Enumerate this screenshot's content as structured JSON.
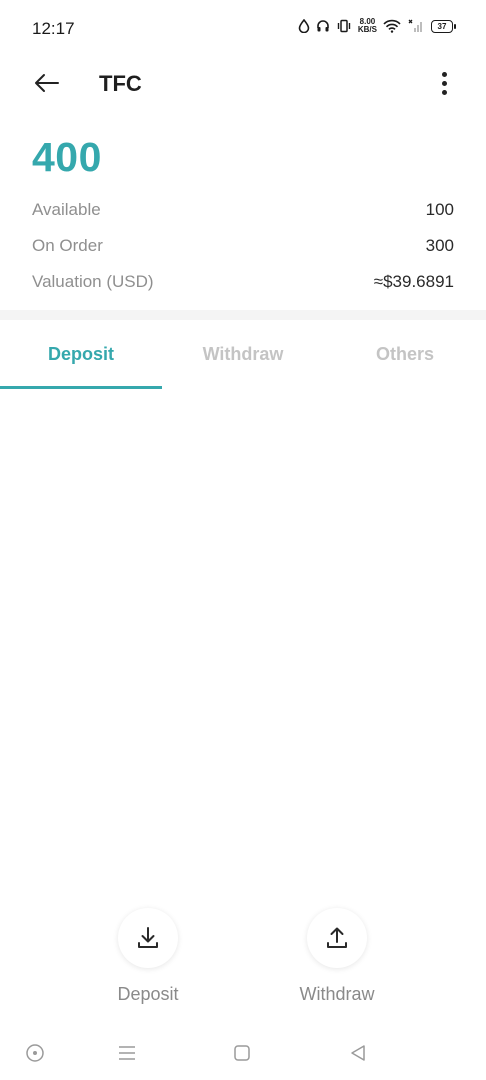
{
  "status_bar": {
    "time": "12:17",
    "speed_value": "8.00",
    "speed_unit": "KB/S",
    "battery": "37"
  },
  "header": {
    "title": "TFC",
    "back_icon": "arrow-left-icon",
    "menu_icon": "more-vertical-icon"
  },
  "balance": {
    "total": "400",
    "rows": [
      {
        "label": "Available",
        "value": "100"
      },
      {
        "label": "On Order",
        "value": "300"
      },
      {
        "label": "Valuation (USD)",
        "value": "≈$39.6891"
      }
    ]
  },
  "tabs": [
    {
      "label": "Deposit",
      "active": true
    },
    {
      "label": "Withdraw",
      "active": false
    },
    {
      "label": "Others",
      "active": false
    }
  ],
  "actions": [
    {
      "label": "Deposit",
      "icon": "download-icon"
    },
    {
      "label": "Withdraw",
      "icon": "upload-icon"
    }
  ],
  "colors": {
    "accent": "#35a8ad",
    "inactive_tab": "#c4c4c4",
    "muted_text": "#8f8f8f"
  }
}
